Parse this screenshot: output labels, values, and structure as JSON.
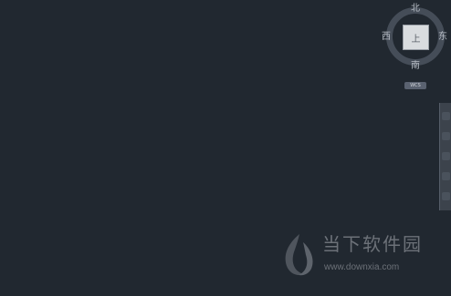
{
  "viewcube": {
    "north": "北",
    "south": "南",
    "west": "西",
    "east": "东",
    "face": "上"
  },
  "wcs": "WCS",
  "navbar": {
    "tools": [
      "full-navigation-wheel",
      "pan",
      "zoom",
      "orbit",
      "showmotion"
    ]
  },
  "watermark": {
    "title": "当下软件园",
    "url": "www.downxia.com"
  },
  "colors": {
    "background": "#212830",
    "ring": "#454d58",
    "cube_face": "#d9dcdf"
  }
}
